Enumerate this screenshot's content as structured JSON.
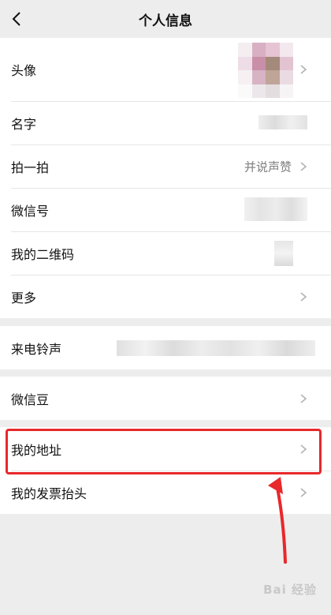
{
  "header": {
    "title": "个人信息"
  },
  "profile": {
    "avatar_label": "头像",
    "name_label": "名字",
    "pat_label": "拍一拍",
    "pat_value": "并说声赞",
    "wechat_id_label": "微信号",
    "qrcode_label": "我的二维码",
    "more_label": "更多"
  },
  "ringtone": {
    "label": "来电铃声"
  },
  "beans": {
    "label": "微信豆"
  },
  "address": {
    "address_label": "我的地址",
    "invoice_label": "我的发票抬头"
  },
  "watermark": "Bai 经验",
  "colors": {
    "highlight": "#e8282b",
    "background": "#ededed"
  },
  "icons": [
    "back-arrow-icon",
    "chevron-right-icon"
  ]
}
